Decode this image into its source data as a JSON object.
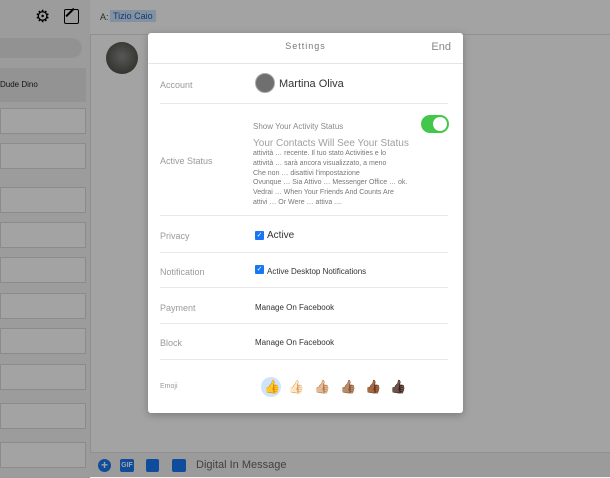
{
  "sidebar": {
    "active_item": "Dude Dino"
  },
  "header": {
    "to_label": "A:",
    "to_name": "Tizio Caio"
  },
  "composer": {
    "placeholder": "Digital In Message"
  },
  "modal": {
    "title": "Settings",
    "done": "End",
    "account": {
      "label": "Account",
      "name": "Martina Oliva"
    },
    "active_status": {
      "label": "Active Status",
      "title": "Show Your Activity Status",
      "subtitle": "Your Contacts Will See Your Status",
      "description_lines": [
        "attività … recente. Il tuo stato Activities e lo",
        "attività … sarà ancora visualizzato, a meno",
        "Che non … disattivi l'impostazione",
        "Ovunque … Sia Attivo … Messenger Office … ok.",
        "Vedrai … When Your Friends And Counts Are",
        "attivi … Or Were … attiva ...."
      ],
      "toggle_on": true
    },
    "privacy": {
      "label": "Privacy",
      "value": "Active",
      "checked": true
    },
    "notification": {
      "label": "Notification",
      "value": "Active Desktop Notifications",
      "checked": true
    },
    "payment": {
      "label": "Payment",
      "value": "Manage On Facebook"
    },
    "block": {
      "label": "Block",
      "value": "Manage On Facebook"
    },
    "emoji": {
      "label": "Emoji",
      "selected": "thumbs-up-yellow"
    }
  },
  "colors": {
    "accent": "#1877f2",
    "toggle": "#43c74a"
  }
}
